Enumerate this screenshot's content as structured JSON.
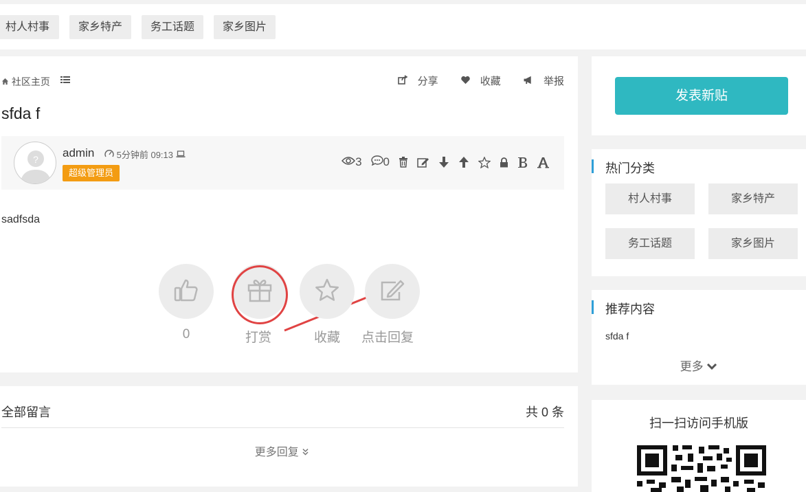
{
  "category_nav": [
    "村人村事",
    "家乡特产",
    "务工话题",
    "家乡图片"
  ],
  "breadcrumb": {
    "home": "社区主页"
  },
  "post_actions": {
    "share": "分享",
    "favorite": "收藏",
    "report": "举报"
  },
  "post": {
    "title": "sfda f",
    "author": "admin",
    "time": "5分钟前 09:13",
    "role": "超级管理员",
    "views": "3",
    "comments": "0",
    "body": "sadfsda"
  },
  "reactions": {
    "like_count": "0",
    "tip_label": "打赏",
    "favorite_label": "收藏",
    "reply_label": "点击回复"
  },
  "comments_section": {
    "title": "全部留言",
    "count": "共 0 条",
    "more": "更多回复"
  },
  "sidebar": {
    "post_button": "发表新贴",
    "hot_title": "热门分类",
    "hot_categories": [
      "村人村事",
      "家乡特产",
      "务工话题",
      "家乡图片"
    ],
    "rec_title": "推荐内容",
    "rec_items": [
      "sfda f"
    ],
    "more": "更多",
    "qr_title": "扫一扫访问手机版"
  },
  "colors": {
    "accent": "#2fb8c1",
    "role_badge": "#f39c12",
    "annotation": "#e04343"
  }
}
